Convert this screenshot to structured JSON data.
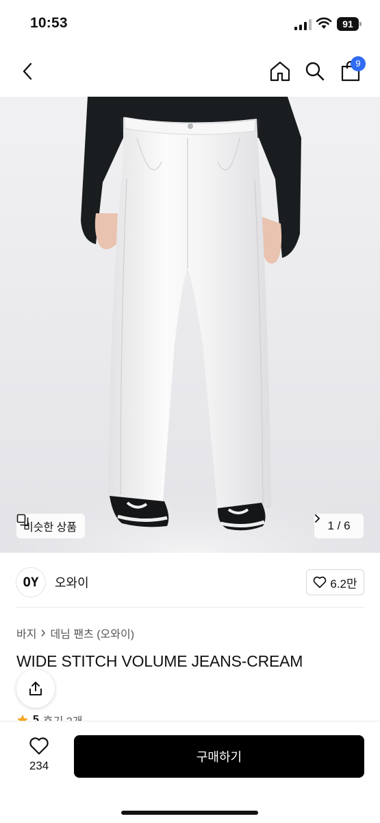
{
  "status_bar": {
    "time": "10:53",
    "battery": "91"
  },
  "nav": {
    "cart_count": "9"
  },
  "product_image": {
    "similar_label": "비슷한 상품",
    "counter": "1 / 6"
  },
  "shop": {
    "logo_text": "OY",
    "name": "오와이",
    "likes": "6.2만"
  },
  "breadcrumb": {
    "category": "바지",
    "subcategory": "데님 팬츠 (오와이)"
  },
  "product": {
    "title": "WIDE STITCH VOLUME JEANS-CREAM"
  },
  "rating": {
    "score": "5",
    "reviews": "후기 2개"
  },
  "bottom_bar": {
    "wish_count": "234",
    "buy_label": "구매하기"
  },
  "colors": {
    "accent_badge": "#2f6bf3",
    "buy_button": "#000000",
    "rating_star": "#f5a623"
  },
  "icons": [
    "chevron-left-icon",
    "home-icon",
    "search-icon",
    "shopping-bag-icon",
    "similar-items-icon",
    "chevron-right-icon",
    "heart-icon",
    "share-icon",
    "star-icon"
  ]
}
